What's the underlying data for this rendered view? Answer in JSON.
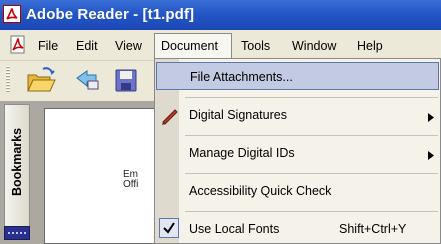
{
  "window": {
    "title": "Adobe Reader - [t1.pdf]"
  },
  "menubar": {
    "items": [
      "File",
      "Edit",
      "View",
      "Document",
      "Tools",
      "Window",
      "Help"
    ],
    "active": "Document"
  },
  "sidebar": {
    "tab_label": "Bookmarks"
  },
  "page": {
    "fragment_lines": [
      "Em",
      "Offi"
    ]
  },
  "document_menu": {
    "items": [
      {
        "label": "File Attachments...",
        "shortcut": "",
        "has_submenu": false,
        "checked": false,
        "highlighted": true,
        "icon": ""
      },
      {
        "label": "Digital Signatures",
        "shortcut": "",
        "has_submenu": true,
        "checked": false,
        "highlighted": false,
        "icon": "signature-pen-icon"
      },
      {
        "label": "Manage Digital IDs",
        "shortcut": "",
        "has_submenu": true,
        "checked": false,
        "highlighted": false,
        "icon": ""
      },
      {
        "label": "Accessibility Quick Check",
        "shortcut": "",
        "has_submenu": false,
        "checked": false,
        "highlighted": false,
        "icon": ""
      },
      {
        "label": "Use Local Fonts",
        "shortcut": "Shift+Ctrl+Y",
        "has_submenu": false,
        "checked": true,
        "highlighted": false,
        "icon": "checkmark-icon"
      }
    ]
  },
  "colors": {
    "titlebar": "#2456c6",
    "menu_highlight": "#c2cbe1",
    "menu_background": "#f4f2e9"
  }
}
